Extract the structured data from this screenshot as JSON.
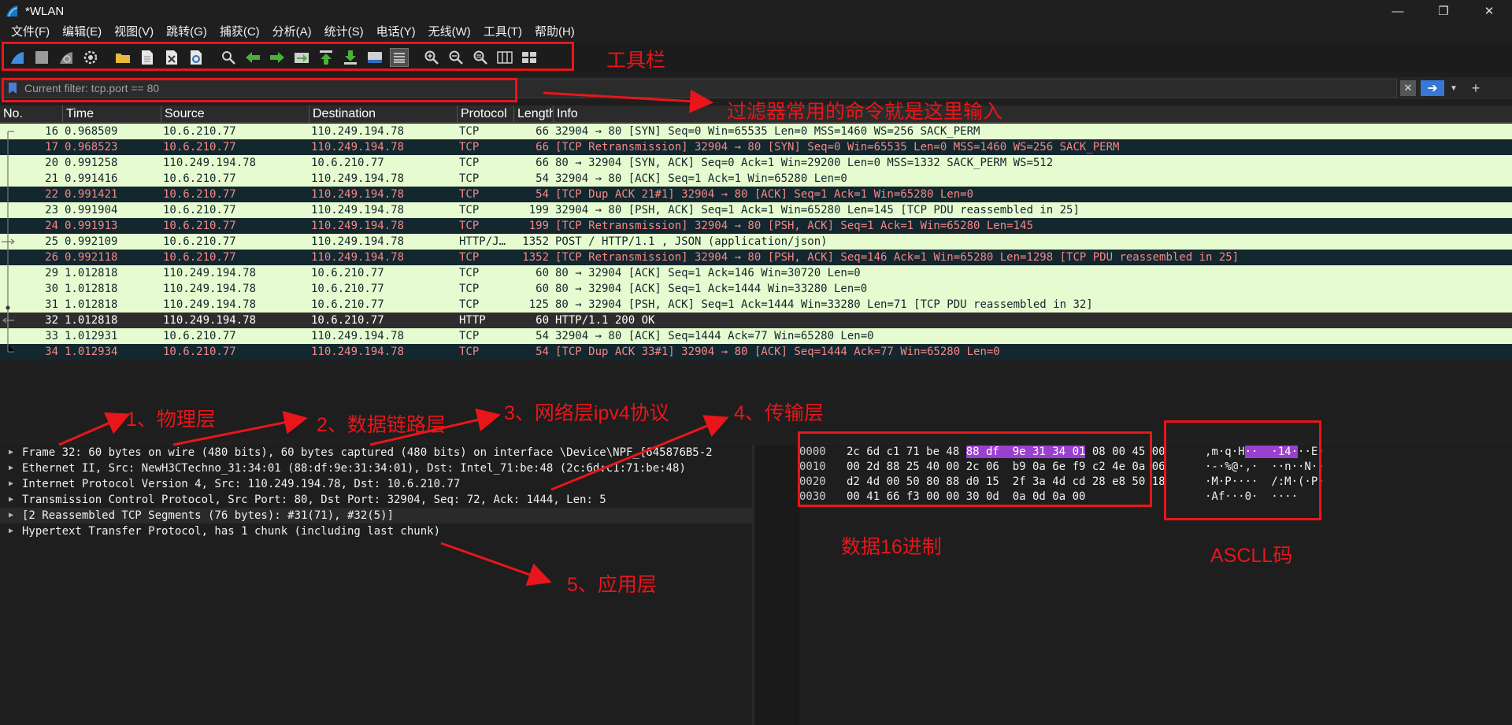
{
  "window": {
    "title": "*WLAN",
    "minimize": "—",
    "maximize": "❐",
    "close": "✕"
  },
  "menu": [
    "文件(F)",
    "编辑(E)",
    "视图(V)",
    "跳转(G)",
    "捕获(C)",
    "分析(A)",
    "统计(S)",
    "电话(Y)",
    "无线(W)",
    "工具(T)",
    "帮助(H)"
  ],
  "toolbar_icons": [
    "shark-start-icon",
    "stop-icon",
    "restart-icon",
    "gear-options-icon",
    "open-folder-icon",
    "file-icon",
    "close-file-icon",
    "reload-icon",
    "find-icon",
    "back-arrow-icon",
    "forward-arrow-icon",
    "goto-packet-icon",
    "first-packet-icon",
    "last-packet-icon",
    "autoscroll-icon",
    "colorize-icon",
    "zoom-in-icon",
    "zoom-out-icon",
    "zoom-normal-icon",
    "resize-columns-icon",
    "layout-icon"
  ],
  "filter": {
    "placeholder": "Current filter: tcp.port == 80"
  },
  "columns": [
    "No.",
    "Time",
    "Source",
    "Destination",
    "Protocol",
    "Length",
    "Info"
  ],
  "packets": [
    {
      "no": "16",
      "time": "0.968509",
      "src": "10.6.210.77",
      "dst": "110.249.194.78",
      "proto": "TCP",
      "len": "66",
      "info": "32904 → 80 [SYN] Seq=0 Win=65535 Len=0 MSS=1460 WS=256 SACK_PERM",
      "style": "green",
      "mark": "first"
    },
    {
      "no": "17",
      "time": "0.968523",
      "src": "10.6.210.77",
      "dst": "110.249.194.78",
      "proto": "TCP",
      "len": "66",
      "info": "[TCP Retransmission] 32904 → 80 [SYN] Seq=0 Win=65535 Len=0 MSS=1460 WS=256 SACK_PERM",
      "style": "dark",
      "mark": "line"
    },
    {
      "no": "20",
      "time": "0.991258",
      "src": "110.249.194.78",
      "dst": "10.6.210.77",
      "proto": "TCP",
      "len": "66",
      "info": "80 → 32904 [SYN, ACK] Seq=0 Ack=1 Win=29200 Len=0 MSS=1332 SACK_PERM WS=512",
      "style": "green",
      "mark": "line"
    },
    {
      "no": "21",
      "time": "0.991416",
      "src": "10.6.210.77",
      "dst": "110.249.194.78",
      "proto": "TCP",
      "len": "54",
      "info": "32904 → 80 [ACK] Seq=1 Ack=1 Win=65280 Len=0",
      "style": "green",
      "mark": "line"
    },
    {
      "no": "22",
      "time": "0.991421",
      "src": "10.6.210.77",
      "dst": "110.249.194.78",
      "proto": "TCP",
      "len": "54",
      "info": "[TCP Dup ACK 21#1] 32904 → 80 [ACK] Seq=1 Ack=1 Win=65280 Len=0",
      "style": "dark",
      "mark": "line"
    },
    {
      "no": "23",
      "time": "0.991904",
      "src": "10.6.210.77",
      "dst": "110.249.194.78",
      "proto": "TCP",
      "len": "199",
      "info": "32904 → 80 [PSH, ACK] Seq=1 Ack=1 Win=65280 Len=145 [TCP PDU reassembled in 25]",
      "style": "green",
      "mark": "line"
    },
    {
      "no": "24",
      "time": "0.991913",
      "src": "10.6.210.77",
      "dst": "110.249.194.78",
      "proto": "TCP",
      "len": "199",
      "info": "[TCP Retransmission] 32904 → 80 [PSH, ACK] Seq=1 Ack=1 Win=65280 Len=145",
      "style": "dark",
      "mark": "line"
    },
    {
      "no": "25",
      "time": "0.992109",
      "src": "10.6.210.77",
      "dst": "110.249.194.78",
      "proto": "HTTP/J…",
      "len": "1352",
      "info": "POST / HTTP/1.1 , JSON (application/json)",
      "style": "green",
      "mark": "request"
    },
    {
      "no": "26",
      "time": "0.992118",
      "src": "10.6.210.77",
      "dst": "110.249.194.78",
      "proto": "TCP",
      "len": "1352",
      "info": "[TCP Retransmission] 32904 → 80 [PSH, ACK] Seq=146 Ack=1 Win=65280 Len=1298 [TCP PDU reassembled in 25]",
      "style": "dark",
      "mark": "line"
    },
    {
      "no": "29",
      "time": "1.012818",
      "src": "110.249.194.78",
      "dst": "10.6.210.77",
      "proto": "TCP",
      "len": "60",
      "info": "80 → 32904 [ACK] Seq=1 Ack=146 Win=30720 Len=0",
      "style": "green",
      "mark": "line"
    },
    {
      "no": "30",
      "time": "1.012818",
      "src": "110.249.194.78",
      "dst": "10.6.210.77",
      "proto": "TCP",
      "len": "60",
      "info": "80 → 32904 [ACK] Seq=1 Ack=1444 Win=33280 Len=0",
      "style": "green",
      "mark": "line"
    },
    {
      "no": "31",
      "time": "1.012818",
      "src": "110.249.194.78",
      "dst": "10.6.210.77",
      "proto": "TCP",
      "len": "125",
      "info": "80 → 32904 [PSH, ACK] Seq=1 Ack=1444 Win=33280 Len=71 [TCP PDU reassembled in 32]",
      "style": "green",
      "mark": "dot"
    },
    {
      "no": "32",
      "time": "1.012818",
      "src": "110.249.194.78",
      "dst": "10.6.210.77",
      "proto": "HTTP",
      "len": "60",
      "info": "HTTP/1.1 200 OK",
      "style": "sel",
      "mark": "response"
    },
    {
      "no": "33",
      "time": "1.012931",
      "src": "10.6.210.77",
      "dst": "110.249.194.78",
      "proto": "TCP",
      "len": "54",
      "info": "32904 → 80 [ACK] Seq=1444 Ack=77 Win=65280 Len=0",
      "style": "green",
      "mark": "line"
    },
    {
      "no": "34",
      "time": "1.012934",
      "src": "10.6.210.77",
      "dst": "110.249.194.78",
      "proto": "TCP",
      "len": "54",
      "info": "[TCP Dup ACK 33#1] 32904 → 80 [ACK] Seq=1444 Ack=77 Win=65280 Len=0",
      "style": "dark",
      "mark": "last"
    }
  ],
  "details": [
    "Frame 32: 60 bytes on wire (480 bits), 60 bytes captured (480 bits) on interface \\Device\\NPF_{645876B5-2",
    "Ethernet II, Src: NewH3CTechno_31:34:01 (88:df:9e:31:34:01), Dst: Intel_71:be:48 (2c:6d:c1:71:be:48)",
    "Internet Protocol Version 4, Src: 110.249.194.78, Dst: 10.6.210.77",
    "Transmission Control Protocol, Src Port: 80, Dst Port: 32904, Seq: 72, Ack: 1444, Len: 5",
    "[2 Reassembled TCP Segments (76 bytes): #31(71), #32(5)]",
    "Hypertext Transfer Protocol, has 1 chunk (including last chunk)"
  ],
  "hex": [
    {
      "offset": "0000",
      "pre": "2c 6d c1 71 be 48 ",
      "hl": "88 df  9e 31 34 01",
      "post": " 08 00 45 00",
      "apre": ",m·q·H",
      "ahl": "··  ·14·",
      "apost": "··E·"
    },
    {
      "offset": "0010",
      "pre": "00 2d 88 25 40 00 2c 06  b9 0a 6e f9 c2 4e 0a 06",
      "hl": "",
      "post": "",
      "apre": "·-·%@·,·  ··n··N··",
      "ahl": "",
      "apost": ""
    },
    {
      "offset": "0020",
      "pre": "d2 4d 00 50 80 88 d0 15  2f 3a 4d cd 28 e8 50 18",
      "hl": "",
      "post": "",
      "apre": "·M·P····  /:M·(·P·",
      "ahl": "",
      "apost": ""
    },
    {
      "offset": "0030",
      "pre": "00 41 66 f3 00 00 30 0d  0a 0d 0a 00",
      "hl": "",
      "post": "",
      "apre": "·Af···0·  ····",
      "ahl": "",
      "apost": ""
    }
  ],
  "annotations": {
    "toolbar": "工具栏",
    "filter": "过滤器常用的命令就是这里输入",
    "layer1": "1、物理层",
    "layer2": "2、数据链路层",
    "layer3": "3、网络层ipv4协议",
    "layer4": "4、传输层",
    "layer5": "5、应用层",
    "hex": "数据16进制",
    "ascii": "ASCLL码"
  },
  "colors": {
    "annotation": "#e8161a",
    "row_green": "#e7fbd0",
    "row_dark": "#12272e",
    "row_dark_text": "#f78787",
    "highlight": "#9b3fd1"
  }
}
